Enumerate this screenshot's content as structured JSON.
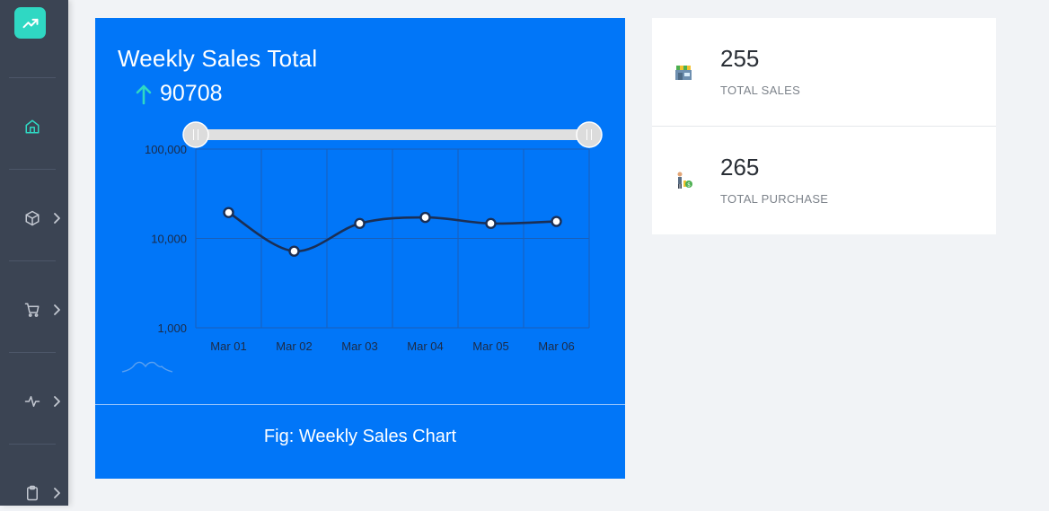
{
  "sidebar": {
    "items": [
      {
        "name": "home",
        "icon": "home-icon",
        "active": true,
        "has_submenu": false
      },
      {
        "name": "products",
        "icon": "box-icon",
        "active": false,
        "has_submenu": true
      },
      {
        "name": "cart",
        "icon": "cart-icon",
        "active": false,
        "has_submenu": true
      },
      {
        "name": "activity",
        "icon": "activity-icon",
        "active": false,
        "has_submenu": true
      },
      {
        "name": "clipboard",
        "icon": "clipboard-icon",
        "active": false,
        "has_submenu": true
      }
    ],
    "logo_icon": "trending-up-icon",
    "accent": "#2fd8c3"
  },
  "chart_card": {
    "title": "Weekly Sales Total",
    "total": "90708",
    "total_icon": "arrow-up-icon",
    "caption": "Fig: Weekly Sales Chart",
    "background": "#0176f8"
  },
  "chart_data": {
    "type": "line",
    "categories": [
      "Mar 01",
      "Mar 02",
      "Mar 03",
      "Mar 04",
      "Mar 05",
      "Mar 06"
    ],
    "series": [
      {
        "values": [
          19500,
          7200,
          14700,
          17200,
          14700,
          15500
        ]
      }
    ],
    "y_scale": "log",
    "ylim": [
      1000,
      100000
    ],
    "y_ticks": [
      {
        "value": 100000,
        "label": "100,000"
      },
      {
        "value": 10000,
        "label": "10,000"
      },
      {
        "value": 1000,
        "label": "1,000"
      }
    ],
    "grid": true,
    "range_slider": true
  },
  "stats": [
    {
      "value": "255",
      "label": "TOTAL SALES",
      "icon": "store-icon"
    },
    {
      "value": "265",
      "label": "TOTAL PURCHASE",
      "icon": "purchase-icon"
    }
  ]
}
